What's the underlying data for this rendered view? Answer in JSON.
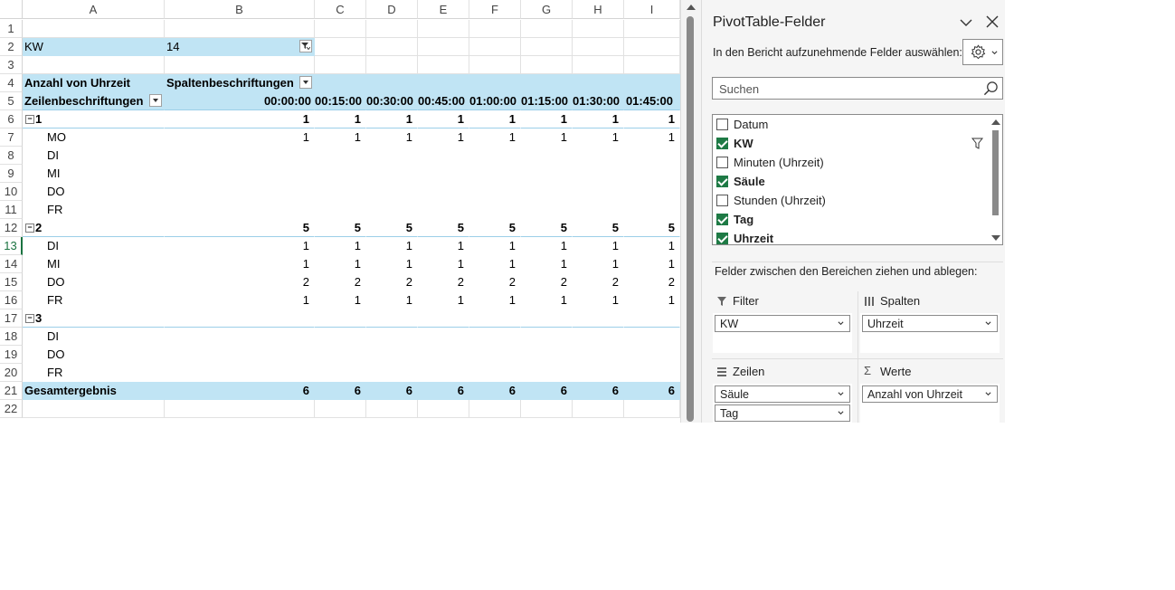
{
  "sheet": {
    "columns": [
      "A",
      "B",
      "C",
      "D",
      "E",
      "F",
      "G",
      "H",
      "I"
    ],
    "rows": [
      "1",
      "2",
      "3",
      "4",
      "5",
      "6",
      "7",
      "8",
      "9",
      "10",
      "11",
      "12",
      "13",
      "14",
      "15",
      "16",
      "17",
      "18",
      "19",
      "20",
      "21",
      "22"
    ],
    "filter_field": "KW",
    "filter_value": "14",
    "values_label": "Anzahl von Uhrzeit",
    "col_labels_header": "Spaltenbeschriftungen",
    "row_labels_header": "Zeilenbeschriftungen",
    "times": [
      "00:00:00",
      "00:15:00",
      "00:30:00",
      "00:45:00",
      "01:00:00",
      "01:15:00",
      "01:30:00",
      "01:45:00"
    ],
    "groups": [
      {
        "label": "1",
        "totals": [
          "1",
          "1",
          "1",
          "1",
          "1",
          "1",
          "1",
          "1"
        ],
        "items": [
          {
            "label": "MO",
            "values": [
              "1",
              "1",
              "1",
              "1",
              "1",
              "1",
              "1",
              "1"
            ]
          },
          {
            "label": "DI",
            "values": [
              "",
              "",
              "",
              "",
              "",
              "",
              "",
              ""
            ]
          },
          {
            "label": "MI",
            "values": [
              "",
              "",
              "",
              "",
              "",
              "",
              "",
              ""
            ]
          },
          {
            "label": "DO",
            "values": [
              "",
              "",
              "",
              "",
              "",
              "",
              "",
              ""
            ]
          },
          {
            "label": "FR",
            "values": [
              "",
              "",
              "",
              "",
              "",
              "",
              "",
              ""
            ]
          }
        ]
      },
      {
        "label": "2",
        "totals": [
          "5",
          "5",
          "5",
          "5",
          "5",
          "5",
          "5",
          "5"
        ],
        "items": [
          {
            "label": "DI",
            "values": [
              "1",
              "1",
              "1",
              "1",
              "1",
              "1",
              "1",
              "1"
            ]
          },
          {
            "label": "MI",
            "values": [
              "1",
              "1",
              "1",
              "1",
              "1",
              "1",
              "1",
              "1"
            ]
          },
          {
            "label": "DO",
            "values": [
              "2",
              "2",
              "2",
              "2",
              "2",
              "2",
              "2",
              "2"
            ]
          },
          {
            "label": "FR",
            "values": [
              "1",
              "1",
              "1",
              "1",
              "1",
              "1",
              "1",
              "1"
            ]
          }
        ]
      },
      {
        "label": "3",
        "totals": [
          "",
          "",
          "",
          "",
          "",
          "",
          "",
          ""
        ],
        "items": [
          {
            "label": "DI",
            "values": [
              "",
              "",
              "",
              "",
              "",
              "",
              "",
              ""
            ]
          },
          {
            "label": "DO",
            "values": [
              "",
              "",
              "",
              "",
              "",
              "",
              "",
              ""
            ]
          },
          {
            "label": "FR",
            "values": [
              "",
              "",
              "",
              "",
              "",
              "",
              "",
              ""
            ]
          }
        ]
      }
    ],
    "grand_total_label": "Gesamtergebnis",
    "grand_totals": [
      "6",
      "6",
      "6",
      "6",
      "6",
      "6",
      "6",
      "6"
    ],
    "selected_row": "13",
    "accent_color": "#c0e4f4"
  },
  "pane": {
    "title": "PivotTable-Felder",
    "choose_label": "In den Bericht aufzunehmende Felder auswählen:",
    "search_placeholder": "Suchen",
    "fields": [
      {
        "label": "Datum",
        "checked": false,
        "bold": false,
        "filtered": false
      },
      {
        "label": "KW",
        "checked": true,
        "bold": true,
        "filtered": true
      },
      {
        "label": "Minuten (Uhrzeit)",
        "checked": false,
        "bold": false,
        "filtered": false
      },
      {
        "label": "Säule",
        "checked": true,
        "bold": true,
        "filtered": false
      },
      {
        "label": "Stunden (Uhrzeit)",
        "checked": false,
        "bold": false,
        "filtered": false
      },
      {
        "label": "Tag",
        "checked": true,
        "bold": true,
        "filtered": false
      },
      {
        "label": "Uhrzeit",
        "checked": true,
        "bold": true,
        "filtered": false
      }
    ],
    "drag_label": "Felder zwischen den Bereichen ziehen und ablegen:",
    "areas": {
      "filter": {
        "label": "Filter",
        "items": [
          "KW"
        ]
      },
      "columns": {
        "label": "Spalten",
        "items": [
          "Uhrzeit"
        ]
      },
      "rows": {
        "label": "Zeilen",
        "items": [
          "Säule",
          "Tag"
        ]
      },
      "values": {
        "label": "Werte",
        "items": [
          "Anzahl von Uhrzeit"
        ]
      }
    },
    "check_color": "#1e7a45"
  }
}
